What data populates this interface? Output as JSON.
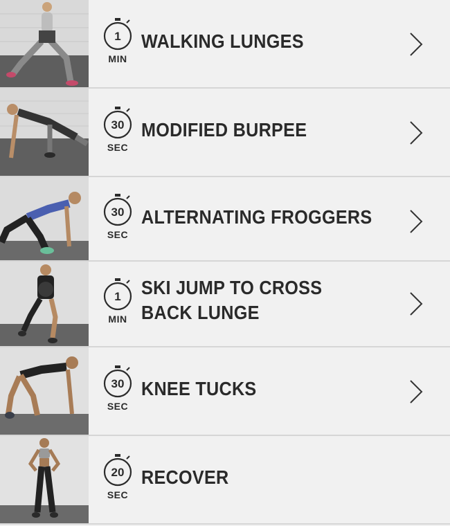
{
  "exercises": [
    {
      "name": "WALKING LUNGES",
      "name_line2": "",
      "duration": "1",
      "unit": "MIN",
      "has_chevron": true
    },
    {
      "name": "MODIFIED BURPEE",
      "name_line2": "",
      "duration": "30",
      "unit": "SEC",
      "has_chevron": true
    },
    {
      "name": "ALTERNATING FROGGERS",
      "name_line2": "",
      "duration": "30",
      "unit": "SEC",
      "has_chevron": true
    },
    {
      "name": "SKI JUMP TO CROSS",
      "name_line2": "BACK LUNGE",
      "duration": "1",
      "unit": "MIN",
      "has_chevron": true
    },
    {
      "name": "KNEE TUCKS",
      "name_line2": "",
      "duration": "30",
      "unit": "SEC",
      "has_chevron": true
    },
    {
      "name": "RECOVER",
      "name_line2": "",
      "duration": "20",
      "unit": "SEC",
      "has_chevron": false
    }
  ],
  "colors": {
    "background": "#f1f1f1",
    "divider": "#d6d6d6",
    "text": "#2a2a2a"
  },
  "icons": {
    "timer": "stopwatch-icon",
    "chevron": "chevron-right-icon"
  }
}
